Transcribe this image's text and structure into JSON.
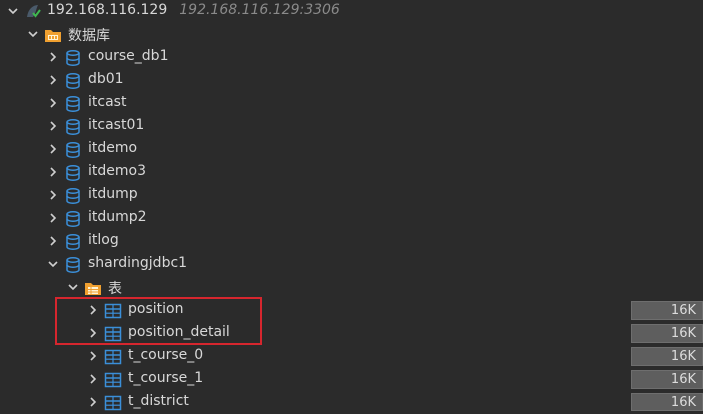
{
  "connection": {
    "name": "192.168.116.129",
    "address": "192.168.116.129:3306"
  },
  "databases_folder": {
    "label": "数据库"
  },
  "databases": [
    {
      "name": "course_db1"
    },
    {
      "name": "db01"
    },
    {
      "name": "itcast"
    },
    {
      "name": "itcast01"
    },
    {
      "name": "itdemo"
    },
    {
      "name": "itdemo3"
    },
    {
      "name": "itdump"
    },
    {
      "name": "itdump2"
    },
    {
      "name": "itlog"
    },
    {
      "name": "shardingjdbc1"
    }
  ],
  "tables_folder": {
    "label": "表"
  },
  "tables": [
    {
      "name": "position",
      "size": "16K"
    },
    {
      "name": "position_detail",
      "size": "16K"
    },
    {
      "name": "t_course_0",
      "size": "16K"
    },
    {
      "name": "t_course_1",
      "size": "16K"
    },
    {
      "name": "t_district",
      "size": "16K"
    }
  ],
  "colors": {
    "accent_db": "#3b8fd9",
    "folder": "#f0a030",
    "highlight": "#d6262e",
    "connected": "#3fb950"
  }
}
